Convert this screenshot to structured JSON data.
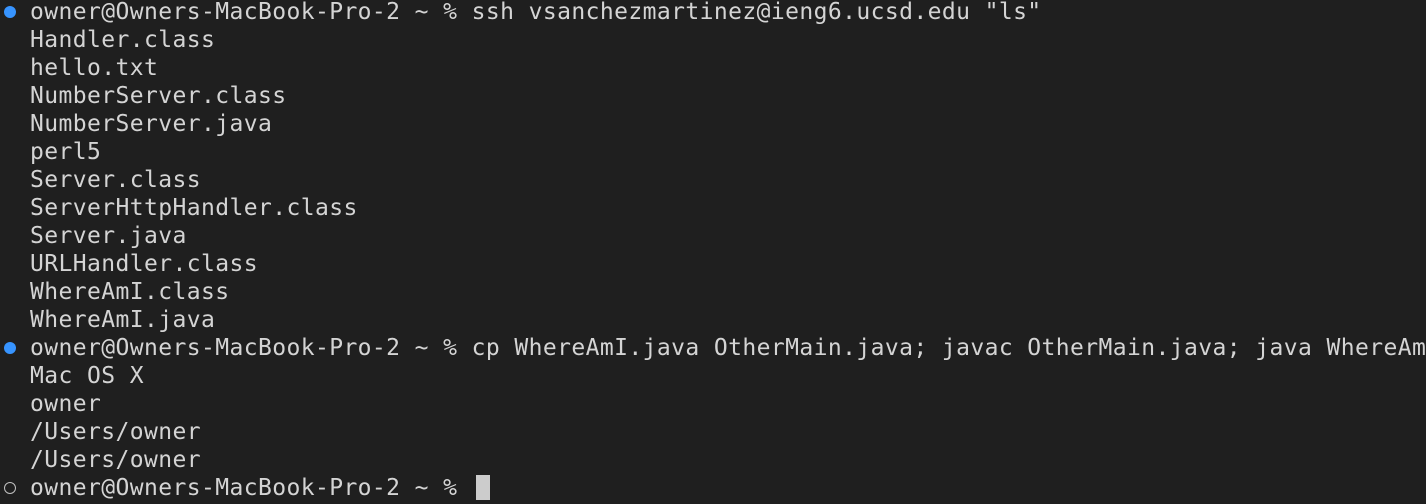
{
  "terminal": {
    "prompt": "owner@Owners-MacBook-Pro-2 ~ %",
    "blocks": [
      {
        "command": "ssh vsanchezmartinez@ieng6.ucsd.edu \"ls\"",
        "output": [
          "Handler.class",
          "hello.txt",
          "NumberServer.class",
          "NumberServer.java",
          "perl5",
          "Server.class",
          "ServerHttpHandler.class",
          "Server.java",
          "URLHandler.class",
          "WhereAmI.class",
          "WhereAmI.java"
        ]
      },
      {
        "command": "cp WhereAmI.java OtherMain.java; javac OtherMain.java; java WhereAmI",
        "output": [
          "Mac OS X",
          "owner",
          "/Users/owner",
          "/Users/owner"
        ]
      }
    ],
    "current_input": ""
  },
  "colors": {
    "background": "#1f1f1f",
    "text": "#d4d4d4",
    "success_marker": "#3794ff",
    "pending_marker": "#c0c0c0"
  }
}
